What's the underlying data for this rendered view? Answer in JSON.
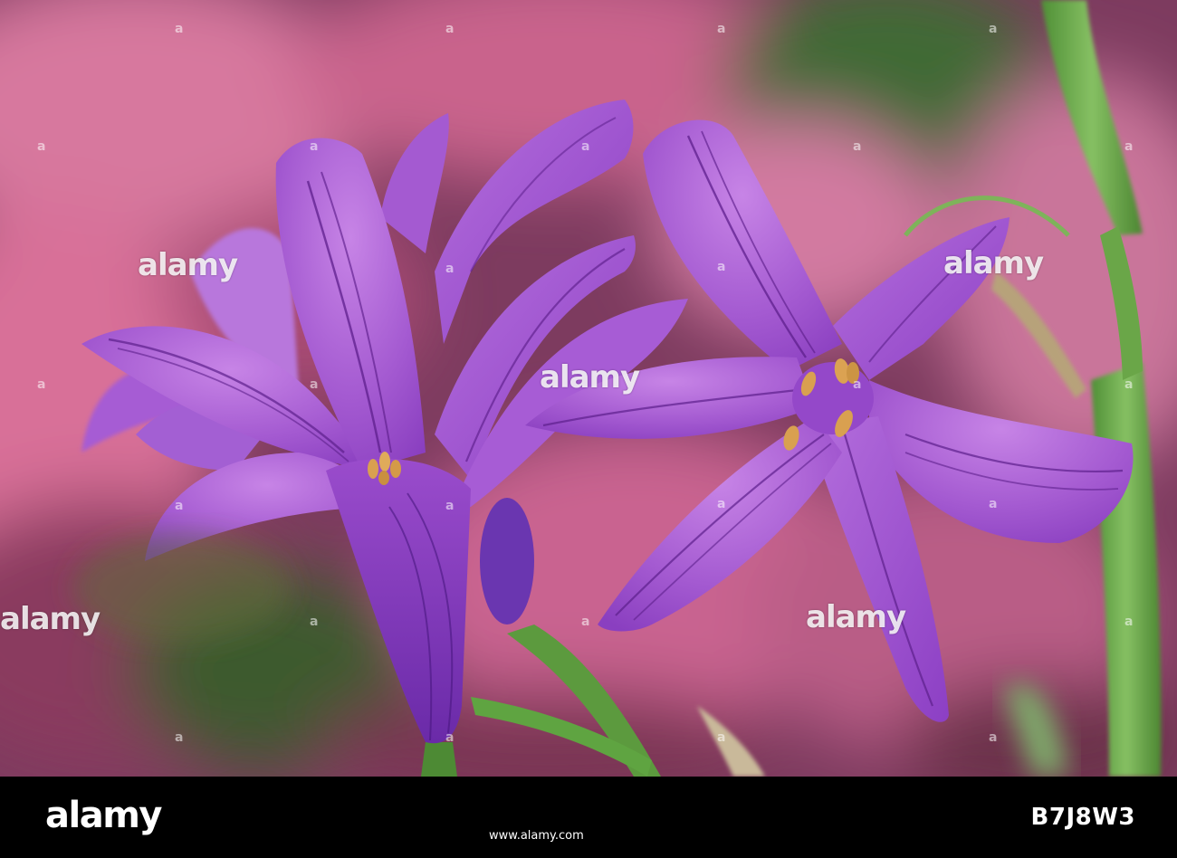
{
  "watermark": {
    "brand": "alamy",
    "small_mark": "a"
  },
  "footer": {
    "logo": "alamy",
    "image_id": "B7J8W3",
    "url": "www.alamy.com"
  },
  "scene": {
    "subject": "flower",
    "colors": {
      "background_pink": "#c96a8f",
      "background_green": "#5f7a3e",
      "petal_light": "#b067d6",
      "petal_dark": "#7a2fb3",
      "vein": "#5d1f8c",
      "stem": "#6fae4a",
      "anther": "#d9a050"
    }
  }
}
